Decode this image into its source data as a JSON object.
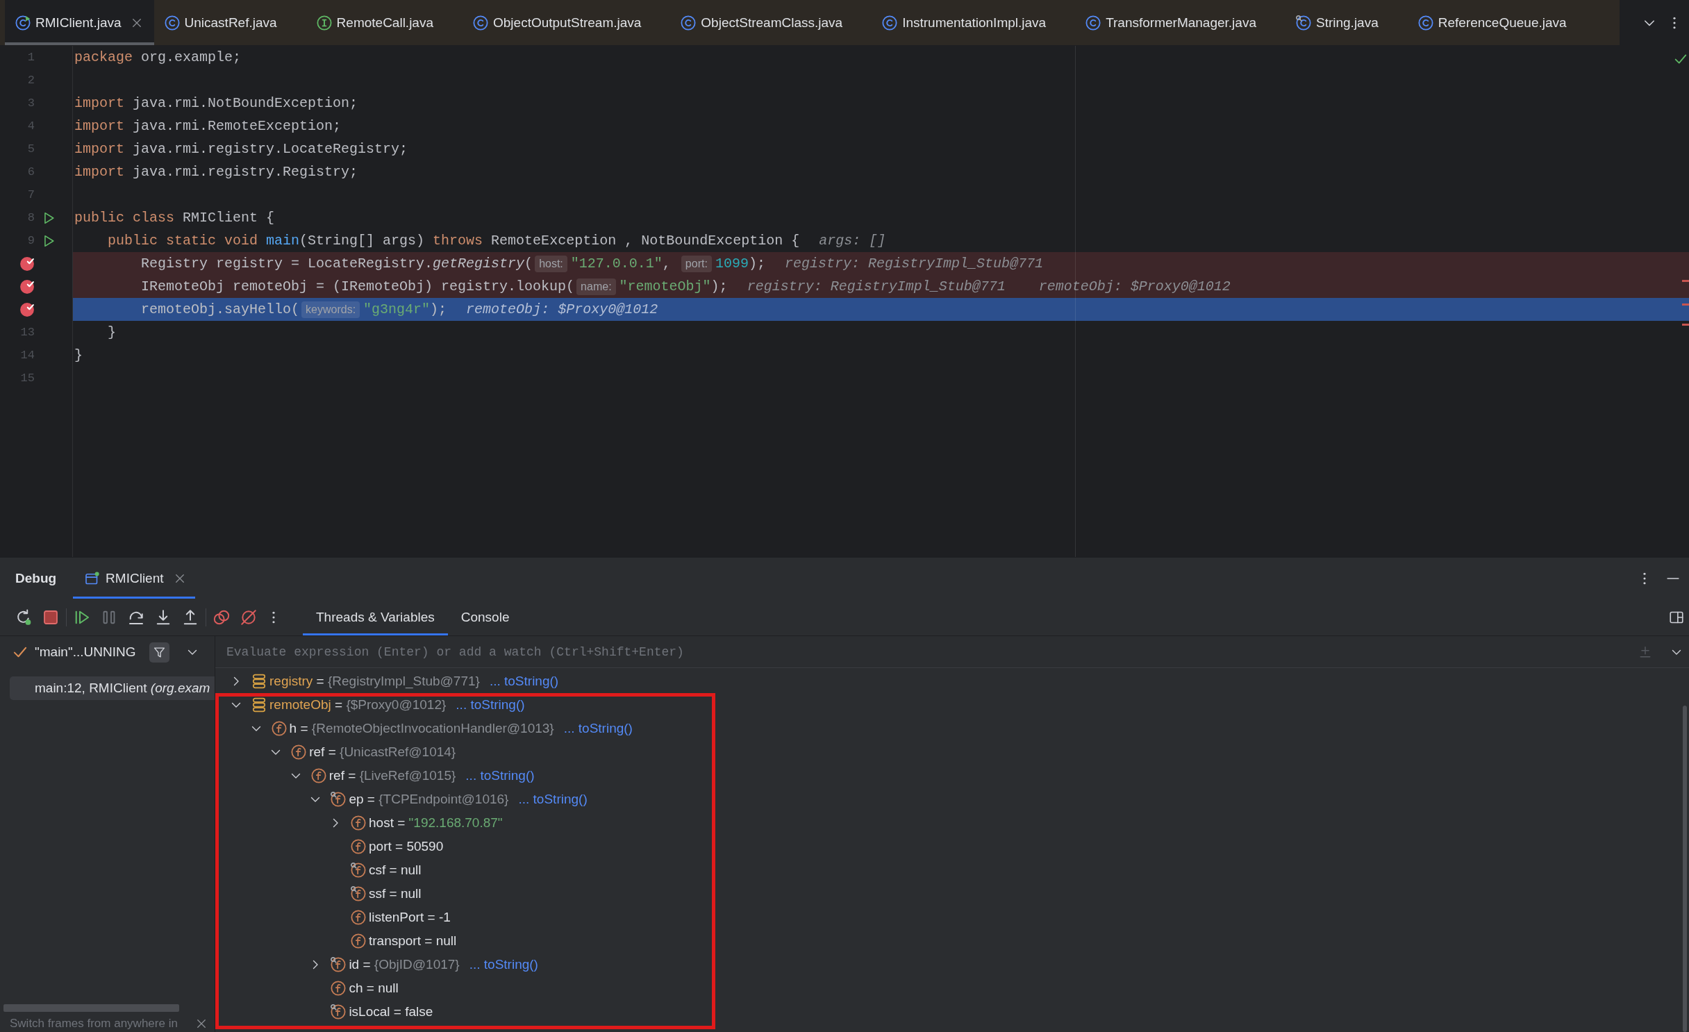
{
  "editor_tabs": [
    {
      "label": "RMIClient.java",
      "kind": "main_class",
      "selected": true
    },
    {
      "label": "UnicastRef.java",
      "kind": "class",
      "selected": false
    },
    {
      "label": "RemoteCall.java",
      "kind": "interface",
      "selected": false
    },
    {
      "label": "ObjectOutputStream.java",
      "kind": "class",
      "selected": false
    },
    {
      "label": "ObjectStreamClass.java",
      "kind": "class",
      "selected": false
    },
    {
      "label": "InstrumentationImpl.java",
      "kind": "class",
      "selected": false
    },
    {
      "label": "TransformerManager.java",
      "kind": "class",
      "selected": false
    },
    {
      "label": "String.java",
      "kind": "final_class",
      "selected": false
    },
    {
      "label": "ReferenceQueue.java",
      "kind": "class",
      "selected": false
    }
  ],
  "editor": {
    "lines": [
      {
        "number": "1",
        "breakpoint": false,
        "current": false,
        "run": false,
        "parts": [
          {
            "kind": "code",
            "tokens": [
              {
                "kind": "keyword",
                "text": "package"
              },
              {
                "kind": "plain",
                "text": " org.example;"
              }
            ]
          }
        ]
      },
      {
        "number": "2",
        "breakpoint": false,
        "current": false,
        "run": false
      },
      {
        "number": "3",
        "breakpoint": false,
        "current": false,
        "run": false,
        "parts": [
          {
            "kind": "code",
            "tokens": [
              {
                "kind": "keyword",
                "text": "import"
              },
              {
                "kind": "plain",
                "text": " java.rmi.NotBoundException;"
              }
            ]
          }
        ]
      },
      {
        "number": "4",
        "breakpoint": false,
        "current": false,
        "run": false,
        "parts": [
          {
            "kind": "code",
            "tokens": [
              {
                "kind": "keyword",
                "text": "import"
              },
              {
                "kind": "plain",
                "text": " java.rmi.RemoteException;"
              }
            ]
          }
        ]
      },
      {
        "number": "5",
        "breakpoint": false,
        "current": false,
        "run": false,
        "parts": [
          {
            "kind": "code",
            "tokens": [
              {
                "kind": "keyword",
                "text": "import"
              },
              {
                "kind": "plain",
                "text": " java.rmi.registry.LocateRegistry;"
              }
            ]
          }
        ]
      },
      {
        "number": "6",
        "breakpoint": false,
        "current": false,
        "run": false,
        "parts": [
          {
            "kind": "code",
            "tokens": [
              {
                "kind": "keyword",
                "text": "import"
              },
              {
                "kind": "plain",
                "text": " java.rmi.registry.Registry;"
              }
            ]
          }
        ]
      },
      {
        "number": "7",
        "breakpoint": false,
        "current": false,
        "run": false
      },
      {
        "number": "8",
        "breakpoint": false,
        "current": false,
        "run": true,
        "parts": [
          {
            "kind": "code",
            "tokens": [
              {
                "kind": "keyword",
                "text": "public class"
              },
              {
                "kind": "plain",
                "text": " RMIClient {"
              }
            ]
          }
        ],
        "children": [
          {
            "number": "9",
            "breakpoint": false,
            "current": false,
            "run": true,
            "parts": [
              {
                "kind": "code",
                "tokens": [
                  {
                    "kind": "keyword",
                    "text": "public static void "
                  },
                  {
                    "kind": "method",
                    "text": "main"
                  },
                  {
                    "kind": "plain",
                    "text": "(String[] args) "
                  },
                  {
                    "kind": "keyword",
                    "text": "throws"
                  },
                  {
                    "kind": "plain",
                    "text": " RemoteException , NotBoundException {"
                  }
                ]
              },
              {
                "kind": "value",
                "text": "args: []"
              }
            ],
            "children": [
              {
                "breakpoint": true,
                "current": false,
                "run": false,
                "parts": [
                  {
                    "kind": "code",
                    "tokens": [
                      {
                        "kind": "plain",
                        "text": "Registry registry = LocateRegistry."
                      },
                      {
                        "kind": "static_call",
                        "text": "getRegistry"
                      },
                      {
                        "kind": "plain",
                        "text": "("
                      }
                    ]
                  },
                  {
                    "kind": "hint",
                    "text": "host:"
                  },
                  {
                    "kind": "code",
                    "tokens": [
                      {
                        "kind": "string",
                        "text": "\"127.0.0.1\""
                      },
                      {
                        "kind": "plain",
                        "text": ", "
                      }
                    ]
                  },
                  {
                    "kind": "hint",
                    "text": "port:"
                  },
                  {
                    "kind": "code",
                    "tokens": [
                      {
                        "kind": "number",
                        "text": "1099"
                      },
                      {
                        "kind": "plain",
                        "text": ");"
                      }
                    ]
                  },
                  {
                    "kind": "value",
                    "text": "registry: RegistryImpl_Stub@771"
                  }
                ]
              },
              {
                "breakpoint": true,
                "current": false,
                "run": false,
                "parts": [
                  {
                    "kind": "code",
                    "tokens": [
                      {
                        "kind": "plain",
                        "text": "IRemoteObj remoteObj = (IRemoteObj) registry.lookup("
                      }
                    ]
                  },
                  {
                    "kind": "hint",
                    "text": "name:"
                  },
                  {
                    "kind": "code",
                    "tokens": [
                      {
                        "kind": "string",
                        "text": "\"remoteObj\""
                      },
                      {
                        "kind": "plain",
                        "text": ");"
                      }
                    ]
                  },
                  {
                    "kind": "value",
                    "text": "registry: RegistryImpl_Stub@771"
                  },
                  {
                    "kind": "value",
                    "text": "remoteObj: $Proxy0@1012"
                  }
                ]
              },
              {
                "breakpoint": true,
                "current": true,
                "run": false,
                "parts": [
                  {
                    "kind": "code",
                    "tokens": [
                      {
                        "kind": "plain",
                        "text": "remoteObj.sayHello("
                      }
                    ]
                  },
                  {
                    "kind": "hint",
                    "text": "keywords:"
                  },
                  {
                    "kind": "code",
                    "tokens": [
                      {
                        "kind": "string",
                        "text": "\"g3ng4r\""
                      },
                      {
                        "kind": "plain",
                        "text": ");"
                      }
                    ]
                  },
                  {
                    "kind": "value",
                    "text": "remoteObj: $Proxy0@1012"
                  }
                ]
              }
            ]
          },
          {
            "number": "13",
            "breakpoint": false,
            "current": false,
            "run": false,
            "parts": [
              {
                "kind": "code",
                "tokens": [
                  {
                    "kind": "plain",
                    "text": "}"
                  }
                ]
              }
            ]
          }
        ]
      },
      {
        "number": "14",
        "breakpoint": false,
        "current": false,
        "run": false,
        "parts": [
          {
            "kind": "code",
            "tokens": [
              {
                "kind": "plain",
                "text": "}"
              }
            ]
          }
        ]
      },
      {
        "number": "15",
        "breakpoint": false,
        "current": false,
        "run": false
      }
    ]
  },
  "debug": {
    "title": "Debug",
    "session_tabs": [
      {
        "label": "RMIClient",
        "selected": true
      }
    ],
    "view_tabs": [
      {
        "label": "Threads & Variables",
        "selected": true
      },
      {
        "label": "Console",
        "selected": false
      }
    ],
    "thread": {
      "label": "\"main\"...UNNING"
    },
    "frames": [
      {
        "text": "main:12, RMIClient *(org.exam*",
        "selected": true
      }
    ],
    "evaluate": {
      "placeholder": "Evaluate expression (Enter) or add a watch (Ctrl+Shift+Enter)"
    },
    "variables": [
      {
        "kind": "variable",
        "name": "registry",
        "operator": "=",
        "value": {
          "kind": "object",
          "text": "{RegistryImpl_Stub@771}"
        },
        "action": "... toString()",
        "expanded": false,
        "final": false,
        "highlighted": false
      },
      {
        "kind": "variable",
        "name": "remoteObj",
        "operator": "=",
        "value": {
          "kind": "object",
          "text": "{$Proxy0@1012}"
        },
        "action": "... toString()",
        "expanded": true,
        "final": false,
        "highlighted": true,
        "children": [
          {
            "kind": "field",
            "name": "h",
            "operator": "=",
            "value": {
              "kind": "object",
              "text": "{RemoteObjectInvocationHandler@1013}"
            },
            "action": "... toString()",
            "expanded": true,
            "final": false,
            "children": [
              {
                "kind": "field",
                "name": "ref",
                "operator": "=",
                "value": {
                  "kind": "object",
                  "text": "{UnicastRef@1014}"
                },
                "expanded": true,
                "final": false,
                "children": [
                  {
                    "kind": "field",
                    "name": "ref",
                    "operator": "=",
                    "value": {
                      "kind": "object",
                      "text": "{LiveRef@1015}"
                    },
                    "action": "... toString()",
                    "expanded": true,
                    "final": false,
                    "children": [
                      {
                        "kind": "field",
                        "name": "ep",
                        "operator": "=",
                        "value": {
                          "kind": "object",
                          "text": "{TCPEndpoint@1016}"
                        },
                        "action": "... toString()",
                        "expanded": true,
                        "final": true,
                        "children": [
                          {
                            "kind": "field",
                            "name": "host",
                            "operator": "=",
                            "value": {
                              "kind": "string",
                              "text": "\"192.168.70.87\""
                            },
                            "expanded": false,
                            "final": false
                          },
                          {
                            "kind": "field",
                            "name": "port",
                            "operator": "=",
                            "value": {
                              "kind": "plain",
                              "text": "50590"
                            },
                            "final": false
                          },
                          {
                            "kind": "field",
                            "name": "csf",
                            "operator": "=",
                            "value": {
                              "kind": "plain",
                              "text": "null"
                            },
                            "final": true
                          },
                          {
                            "kind": "field",
                            "name": "ssf",
                            "operator": "=",
                            "value": {
                              "kind": "plain",
                              "text": "null"
                            },
                            "final": true
                          },
                          {
                            "kind": "field",
                            "name": "listenPort",
                            "operator": "=",
                            "value": {
                              "kind": "plain",
                              "text": "-1"
                            },
                            "final": false
                          },
                          {
                            "kind": "field",
                            "name": "transport",
                            "operator": "=",
                            "value": {
                              "kind": "plain",
                              "text": "null"
                            },
                            "final": false
                          }
                        ]
                      },
                      {
                        "kind": "field",
                        "name": "id",
                        "operator": "=",
                        "value": {
                          "kind": "object",
                          "text": "{ObjID@1017}"
                        },
                        "action": "... toString()",
                        "expanded": false,
                        "final": true
                      },
                      {
                        "kind": "field",
                        "name": "ch",
                        "operator": "=",
                        "value": {
                          "kind": "plain",
                          "text": "null"
                        },
                        "final": false
                      },
                      {
                        "kind": "field",
                        "name": "isLocal",
                        "operator": "=",
                        "value": {
                          "kind": "plain",
                          "text": "false"
                        },
                        "final": true
                      }
                    ]
                  }
                ]
              }
            ]
          }
        ]
      }
    ],
    "tip": "Switch frames from anywhere in"
  }
}
